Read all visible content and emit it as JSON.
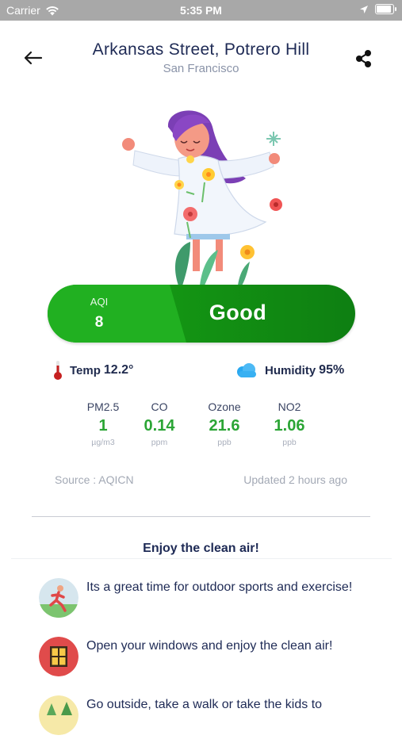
{
  "status_bar": {
    "carrier": "Carrier",
    "time": "5:35 PM"
  },
  "header": {
    "title": "Arkansas Street, Potrero Hill",
    "subtitle": "San Francisco"
  },
  "aqi": {
    "label": "AQI",
    "value": "8",
    "status": "Good",
    "color": "#1aa61a"
  },
  "weather": {
    "temp_label": "Temp",
    "temp_value": "12.2°",
    "humidity_label": "Humidity",
    "humidity_value": "95%"
  },
  "pollutants": [
    {
      "name": "PM2.5",
      "value": "1",
      "unit": "µg/m3"
    },
    {
      "name": "CO",
      "value": "0.14",
      "unit": "ppm"
    },
    {
      "name": "Ozone",
      "value": "21.6",
      "unit": "ppb"
    },
    {
      "name": "NO2",
      "value": "1.06",
      "unit": "ppb"
    }
  ],
  "source": "Source : AQICN",
  "updated": "Updated 2 hours ago",
  "section_title": "Enjoy the clean air!",
  "tips": [
    {
      "icon": "runner-icon",
      "text": "Its a great time for outdoor sports and exercise!"
    },
    {
      "icon": "window-icon",
      "text": "Open your windows and enjoy the clean air!"
    },
    {
      "icon": "park-icon",
      "text": "Go outside, take a walk or take the kids to"
    }
  ]
}
